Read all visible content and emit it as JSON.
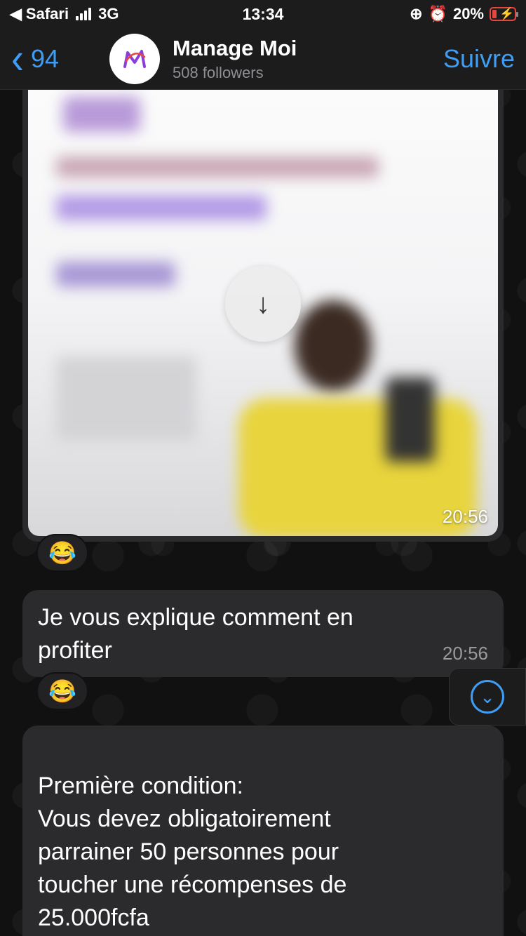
{
  "status_bar": {
    "carrier_back": "Safari",
    "network": "3G",
    "time": "13:34",
    "battery": "20%"
  },
  "header": {
    "back_count": "94",
    "channel_name": "Manage Moi",
    "followers": "508 followers",
    "follow_label": "Suivre"
  },
  "messages": [
    {
      "type": "media",
      "time": "20:56",
      "reaction": "😂"
    },
    {
      "type": "text",
      "text": "Je vous explique comment en profiter",
      "time": "20:56",
      "reaction": "😂"
    },
    {
      "type": "text",
      "text": "Première condition:\nVous devez obligatoirement parrainer 50 personnes pour toucher une récompenses de 25.000fcfa"
    }
  ],
  "colors": {
    "accent": "#3e9ef5",
    "bubble": "#2b2b2d",
    "header": "#1c1c1d"
  },
  "icons": [
    "back-chevron-icon",
    "download-icon",
    "scroll-down-icon",
    "alarm-icon",
    "lock-rotation-icon",
    "battery-charging-icon"
  ]
}
